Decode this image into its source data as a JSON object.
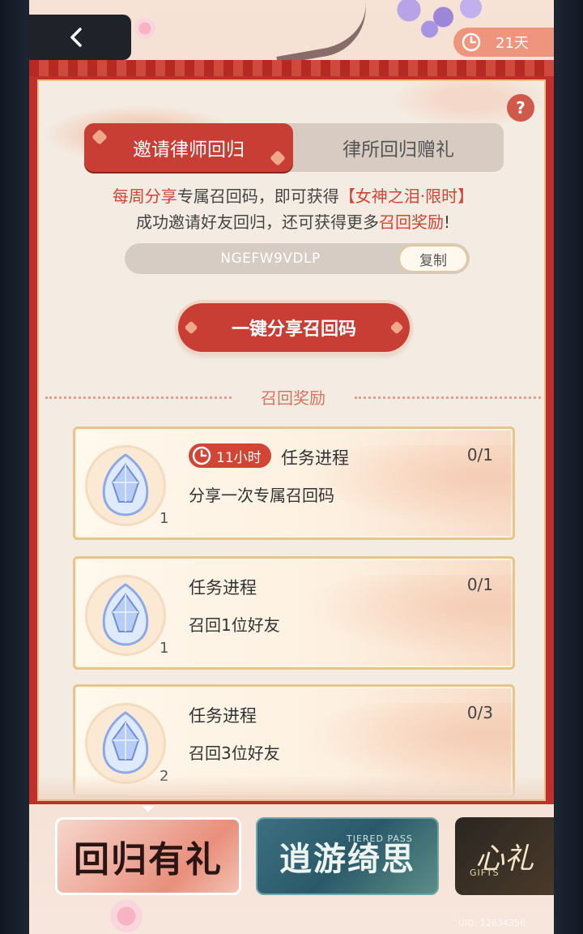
{
  "header": {
    "back_label": "",
    "timer_value": "21天"
  },
  "panel": {
    "help_label": "?",
    "tabs": [
      {
        "label": "邀请律师回归",
        "active": true
      },
      {
        "label": "律所回归赠礼",
        "active": false
      }
    ],
    "desc_line1": {
      "part1": "每周分享",
      "part2": "专属召回码，即可获得",
      "part3": "【女神之泪·限时】"
    },
    "desc_line2": {
      "part1": "成功邀请好友回归，还可获得更多",
      "part2": "召回奖励",
      "part3": "!"
    },
    "invite_code": "NGEFW9VDLP",
    "copy_label": "复制",
    "share_button_label": "一键分享召回码",
    "section_title": "召回奖励"
  },
  "tasks": [
    {
      "time_left": "11小时",
      "title": "任务进程",
      "progress": "0/1",
      "description": "分享一次专属召回码",
      "reward_qty": "1"
    },
    {
      "title": "任务进程",
      "progress": "0/1",
      "description": "召回1位好友",
      "reward_qty": "1"
    },
    {
      "title": "任务进程",
      "progress": "0/3",
      "description": "召回3位好友",
      "reward_qty": "2"
    }
  ],
  "banners": [
    {
      "label": "回归有礼",
      "selected": true
    },
    {
      "label": "逍游绮思",
      "sub": "TIERED PASS"
    },
    {
      "label": "心礼",
      "sub": "GIFTS"
    }
  ],
  "uid_text": "UID: 12634356",
  "colors": {
    "primary_red": "#c83e34",
    "accent_red": "#d24535",
    "gold_border": "#e6c48b",
    "panel_bg": "#f4ece3"
  }
}
